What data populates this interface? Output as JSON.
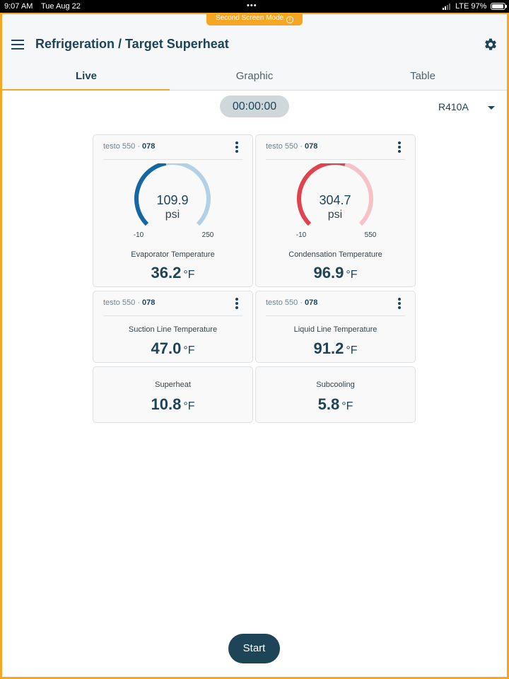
{
  "status_bar": {
    "time": "9:07 AM",
    "date": "Tue Aug 22",
    "dots": "•••",
    "network": "LTE 97%"
  },
  "second_screen": {
    "label": "Second Screen Mode",
    "info_icon": "i"
  },
  "header": {
    "title": "Refrigeration / Target Superheat",
    "menu_icon": "hamburger-icon",
    "settings_icon": "gear-icon"
  },
  "tabs": [
    {
      "label": "Live",
      "active": true
    },
    {
      "label": "Graphic",
      "active": false
    },
    {
      "label": "Table",
      "active": false
    }
  ],
  "timer": "00:00:00",
  "refrigerant": {
    "selected": "R410A"
  },
  "cards": {
    "evap": {
      "device": "testo 550",
      "sep": " · ",
      "id": "078",
      "gauge": {
        "value": "109.9",
        "unit": "psi",
        "min": "-10",
        "max": "250",
        "level": 0.46,
        "color": "#1467a3",
        "track": "#b3d1e6"
      },
      "label": "Evaporator Temperature",
      "reading": "36.2",
      "unit": "°F"
    },
    "cond": {
      "device": "testo 550",
      "sep": " · ",
      "id": "078",
      "gauge": {
        "value": "304.7",
        "unit": "psi",
        "min": "-10",
        "max": "550",
        "level": 0.56,
        "color": "#e2424e",
        "track": "#f5c2c6"
      },
      "label": "Condensation Temperature",
      "reading": "96.9",
      "unit": "°F"
    },
    "suction": {
      "device": "testo 550",
      "sep": " · ",
      "id": "078",
      "label": "Suction Line Temperature",
      "reading": "47.0",
      "unit": "°F"
    },
    "liquid": {
      "device": "testo 550",
      "sep": " · ",
      "id": "078",
      "label": "Liquid Line Temperature",
      "reading": "91.2",
      "unit": "°F"
    },
    "superheat": {
      "label": "Superheat",
      "reading": "10.8",
      "unit": "°F"
    },
    "subcooling": {
      "label": "Subcooling",
      "reading": "5.8",
      "unit": "°F"
    }
  },
  "start_button": "Start",
  "colors": {
    "accent": "#f5a623",
    "primary": "#1e4457"
  }
}
